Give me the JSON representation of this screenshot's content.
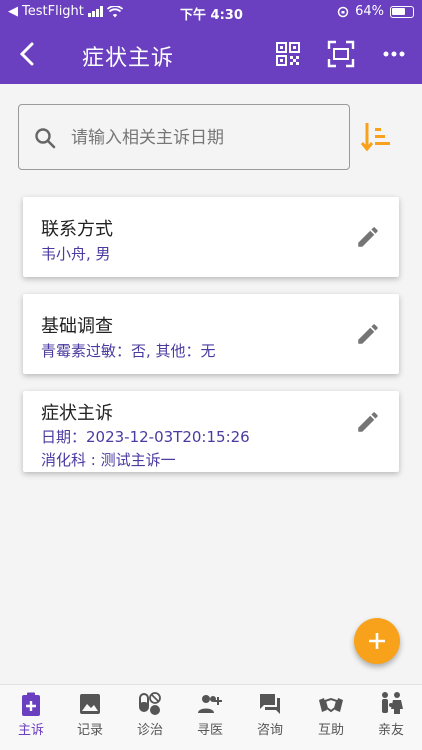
{
  "status_bar": {
    "carrier": "TestFlight",
    "time": "下午 4:30",
    "battery": "64%"
  },
  "header": {
    "title": "症状主诉"
  },
  "search": {
    "placeholder": "请输入相关主诉日期"
  },
  "cards": [
    {
      "title": "联系方式",
      "lines": [
        "韦小舟, 男"
      ]
    },
    {
      "title": "基础调查",
      "lines": [
        "青霉素过敏：否, 其他：无"
      ]
    },
    {
      "title": "症状主诉",
      "lines": [
        "日期：2023-12-03T20:15:26",
        "消化科 : 测试主诉一"
      ]
    }
  ],
  "nav": [
    {
      "label": "主诉",
      "icon": "clipboard-plus-icon",
      "active": true
    },
    {
      "label": "记录",
      "icon": "photo-icon"
    },
    {
      "label": "诊治",
      "icon": "pills-icon"
    },
    {
      "label": "寻医",
      "icon": "group-add-icon"
    },
    {
      "label": "咨询",
      "icon": "chat-icon"
    },
    {
      "label": "互助",
      "icon": "handshake-icon"
    },
    {
      "label": "亲友",
      "icon": "family-icon"
    }
  ],
  "colors": {
    "primary": "#6a3fc0",
    "accent": "#f7a21a",
    "card_text": "#4b3aa0"
  }
}
